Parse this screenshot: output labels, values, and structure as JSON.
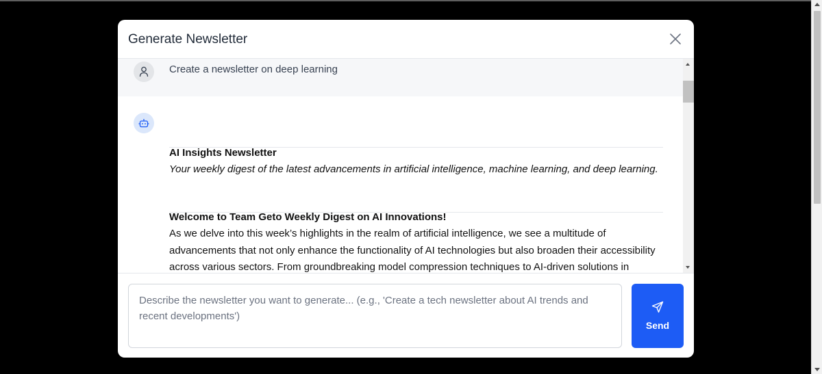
{
  "modal": {
    "title": "Generate Newsletter"
  },
  "messages": {
    "user": {
      "text": "Create a newsletter on deep learning",
      "icon": "user-icon"
    },
    "bot": {
      "icon": "bot-icon",
      "newsletter_title": "AI Insights Newsletter",
      "newsletter_subtitle": "Your weekly digest of the latest advancements in artificial intelligence, machine learning, and deep learning.",
      "section_heading": "Welcome to Team Geto Weekly Digest on AI Innovations!",
      "section_body": "As we delve into this week’s highlights in the realm of artificial intelligence, we see a multitude of advancements that not only enhance the functionality of AI technologies but also broaden their accessibility across various sectors. From groundbreaking model compression techniques to AI-driven solutions in"
    }
  },
  "input": {
    "placeholder": "Describe the newsletter you want to generate... (e.g., 'Create a tech newsletter about AI trends and recent developments')",
    "value": ""
  },
  "send_button": {
    "label": "Send",
    "icon": "send-icon",
    "color": "#1d5cf5"
  },
  "colors": {
    "backdrop": "#000000",
    "user_row_bg": "#f6f7f9",
    "bot_avatar_bg": "#dbe7fb"
  }
}
